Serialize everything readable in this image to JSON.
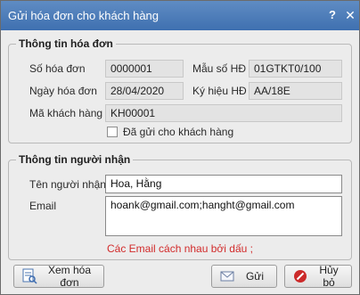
{
  "window": {
    "title": "Gửi hóa đơn cho khách hàng",
    "help_glyph": "?",
    "close_glyph": "✕"
  },
  "invoice_info": {
    "title": "Thông tin hóa đơn",
    "number_label": "Số hóa đơn",
    "number_value": "0000001",
    "form_label": "Mẫu số HĐ",
    "form_value": "01GTKT0/100",
    "date_label": "Ngày hóa đơn",
    "date_value": "28/04/2020",
    "symbol_label": "Ký hiệu HĐ",
    "symbol_value": "AA/18E",
    "customer_label": "Mã khách hàng",
    "customer_value": "KH00001",
    "sent_label": "Đã gửi cho khách hàng",
    "sent_checked": false
  },
  "recipient_info": {
    "title": "Thông tin người nhận",
    "name_label": "Tên người nhận",
    "name_value": "Hoa, Hằng",
    "email_label": "Email",
    "email_value": "hoank@gmail.com;hanght@gmail.com",
    "hint": "Các Email cách nhau bởi dấu ;"
  },
  "buttons": {
    "view": "Xem hóa đơn",
    "send": "Gửi",
    "cancel": "Hủy bỏ"
  },
  "colors": {
    "title_bar": "#4a7bb8",
    "hint": "#d22b2b",
    "cancel_icon": "#cc2a2a"
  },
  "icons": {
    "view": "invoice-view-icon",
    "send": "envelope-icon",
    "cancel": "cancel-icon"
  }
}
